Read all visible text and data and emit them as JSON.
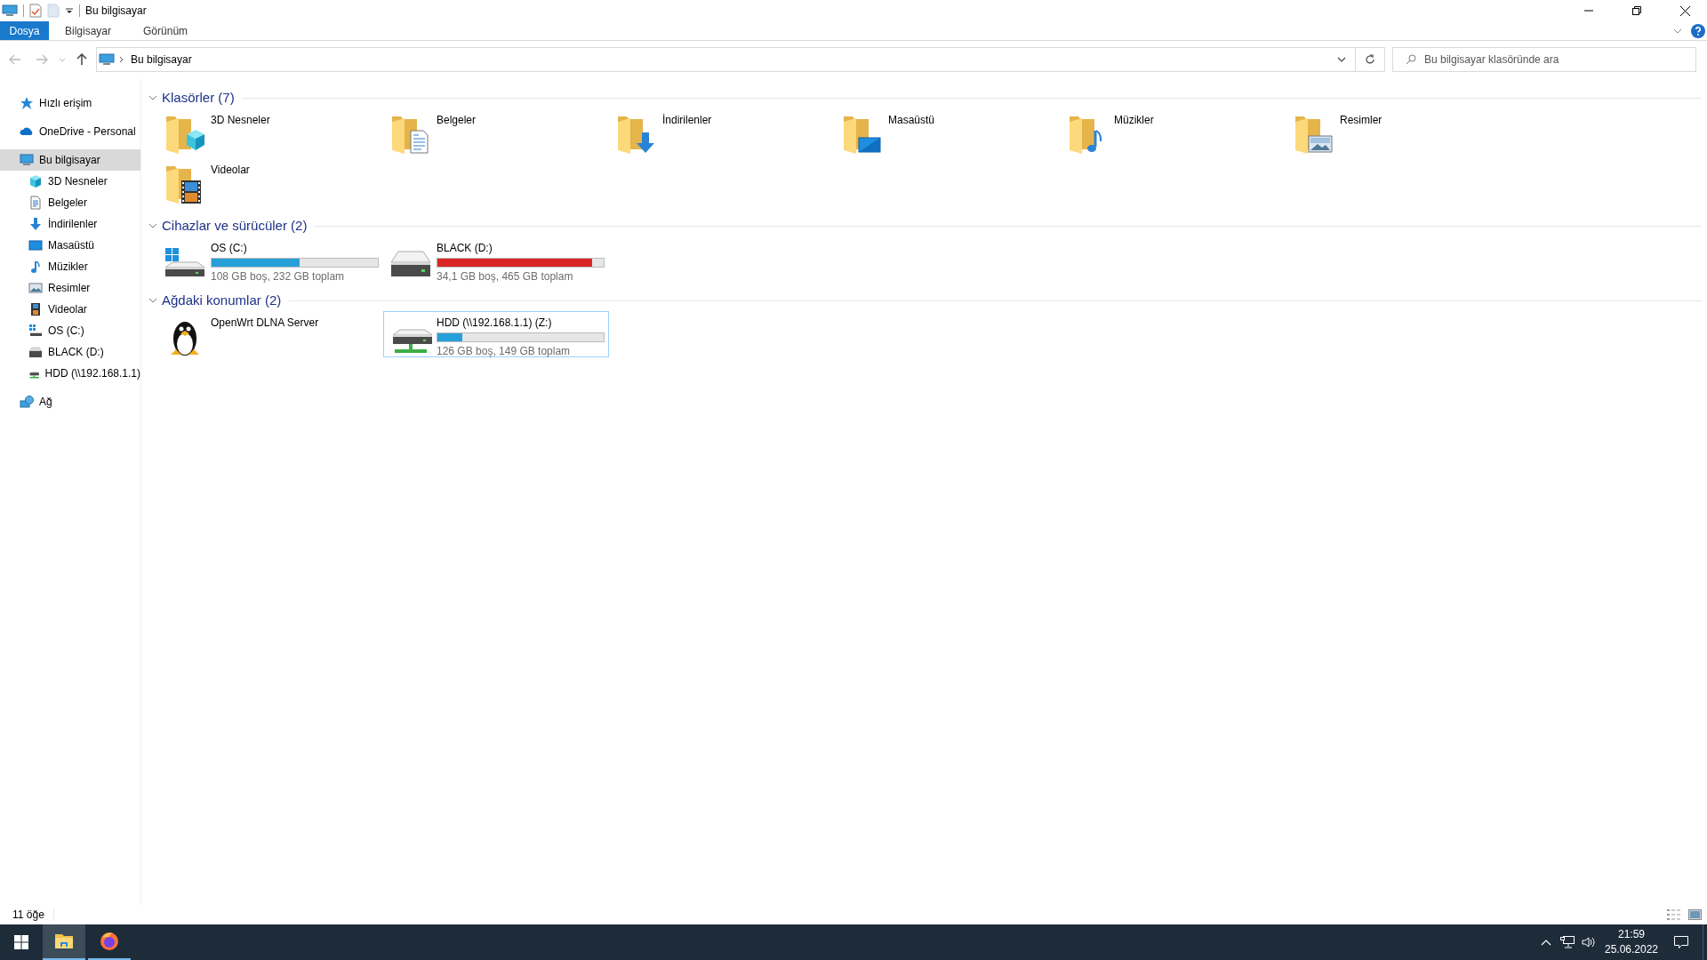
{
  "window": {
    "title": "Bu bilgisayar"
  },
  "ribbon": {
    "file_tab": "Dosya",
    "tabs": [
      {
        "label": "Bilgisayar",
        "selected": false
      },
      {
        "label": "Görünüm",
        "selected": false
      }
    ]
  },
  "address_bar": {
    "path": [
      "Bu bilgisayar"
    ]
  },
  "search": {
    "placeholder": "Bu bilgisayar klasöründe ara"
  },
  "sidebar": {
    "items": [
      {
        "label": "Hızlı erişim",
        "kind": "quick-access",
        "selected": false
      },
      {
        "label": "OneDrive - Personal",
        "kind": "cloud",
        "selected": false
      },
      {
        "label": "Bu bilgisayar",
        "kind": "computer",
        "selected": true,
        "children": [
          {
            "label": "3D Nesneler",
            "kind": "objects",
            "selected": false
          },
          {
            "label": "Belgeler",
            "kind": "documents",
            "selected": false
          },
          {
            "label": "İndirilenler",
            "kind": "downloads",
            "selected": false
          },
          {
            "label": "Masaüstü",
            "kind": "desktop",
            "selected": false
          },
          {
            "label": "Müzikler",
            "kind": "music",
            "selected": false
          },
          {
            "label": "Resimler",
            "kind": "pictures",
            "selected": false
          },
          {
            "label": "Videolar",
            "kind": "videos",
            "selected": false
          },
          {
            "label": "OS (C:)",
            "kind": "system-drive",
            "selected": false
          },
          {
            "label": "BLACK (D:)",
            "kind": "drive",
            "selected": false
          },
          {
            "label": "HDD (\\\\192.168.1.1)",
            "kind": "network-drive",
            "selected": false
          }
        ]
      },
      {
        "label": "Ağ",
        "kind": "network",
        "selected": false
      }
    ]
  },
  "sections": [
    {
      "title": "Klasörler (7)",
      "expanded": true,
      "items": [
        {
          "label": "3D Nesneler",
          "kind": "objects",
          "selected": false
        },
        {
          "label": "Belgeler",
          "kind": "documents",
          "selected": false
        },
        {
          "label": "İndirilenler",
          "kind": "downloads",
          "selected": false
        },
        {
          "label": "Masaüstü",
          "kind": "desktop",
          "selected": false
        },
        {
          "label": "Müzikler",
          "kind": "music",
          "selected": false
        },
        {
          "label": "Resimler",
          "kind": "pictures",
          "selected": false
        },
        {
          "label": "Videolar",
          "kind": "videos",
          "selected": false
        }
      ]
    },
    {
      "title": "Cihazlar ve sürücüler (2)",
      "expanded": true,
      "items": [
        {
          "label": "OS (C:)",
          "kind": "system-drive",
          "level": 0.53,
          "caption": "108 GB boş, 232 GB toplam",
          "selected": false
        },
        {
          "label": "BLACK (D:)",
          "kind": "drive",
          "level": 0.93,
          "caption": "34,1 GB boş, 465 GB toplam",
          "selected": false
        }
      ]
    },
    {
      "title": "Ağdaki konumlar (2)",
      "expanded": true,
      "items": [
        {
          "label": "OpenWrt DLNA Server",
          "kind": "media-server",
          "selected": false
        },
        {
          "label": "HDD (\\\\192.168.1.1) (Z:)",
          "kind": "network-drive",
          "level": 0.15,
          "caption": "126 GB boş, 149 GB toplam",
          "selected": true
        }
      ]
    }
  ],
  "status_bar": {
    "item_count": "11 öğe"
  },
  "taskbar": {
    "apps": [
      {
        "kind": "file-explorer",
        "active": true
      },
      {
        "kind": "firefox",
        "active": false
      }
    ],
    "clock": {
      "time": "21:59",
      "date": "25.06.2022"
    }
  }
}
